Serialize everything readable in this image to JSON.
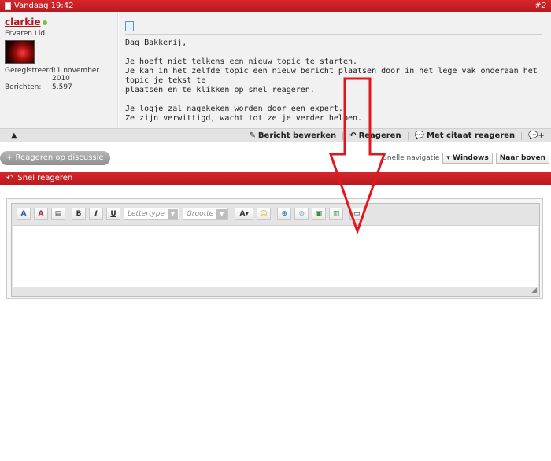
{
  "post": {
    "date": "Vandaag 19:42",
    "number": "#2",
    "user": {
      "name": "clarkie",
      "rank": "Ervaren Lid",
      "registered_label": "Geregistreerd:",
      "registered_value": "11 november 2010",
      "posts_label": "Berichten:",
      "posts_value": "5.597"
    },
    "message": "Dag Bakkerij,\n\nJe hoeft niet telkens een nieuw topic te starten.\nJe kan in het zelfde topic een nieuw bericht plaatsen door in het lege vak onderaan het topic je tekst te\nplaatsen en te klikken op snel reageren.\n\nJe logje zal nagekeken worden door een expert.\nZe zijn verwittigd, wacht tot ze je verder helpen.",
    "actions": {
      "edit": "Bericht bewerken",
      "reply": "Reageren",
      "quote": "Met citaat reageren"
    }
  },
  "reply_discussion_label": "+ Reageren op discussie",
  "quicknav": {
    "label": "Snelle navigatie",
    "windows": "Windows",
    "top": "Naar boven"
  },
  "quick_reply": {
    "title": "Snel reageren",
    "font_placeholder": "Lettertype",
    "size_placeholder": "Grootte"
  },
  "colors": {
    "header_red": "#c8202a",
    "username": "#b4151c",
    "annotation_arrow": "#e0171f"
  }
}
